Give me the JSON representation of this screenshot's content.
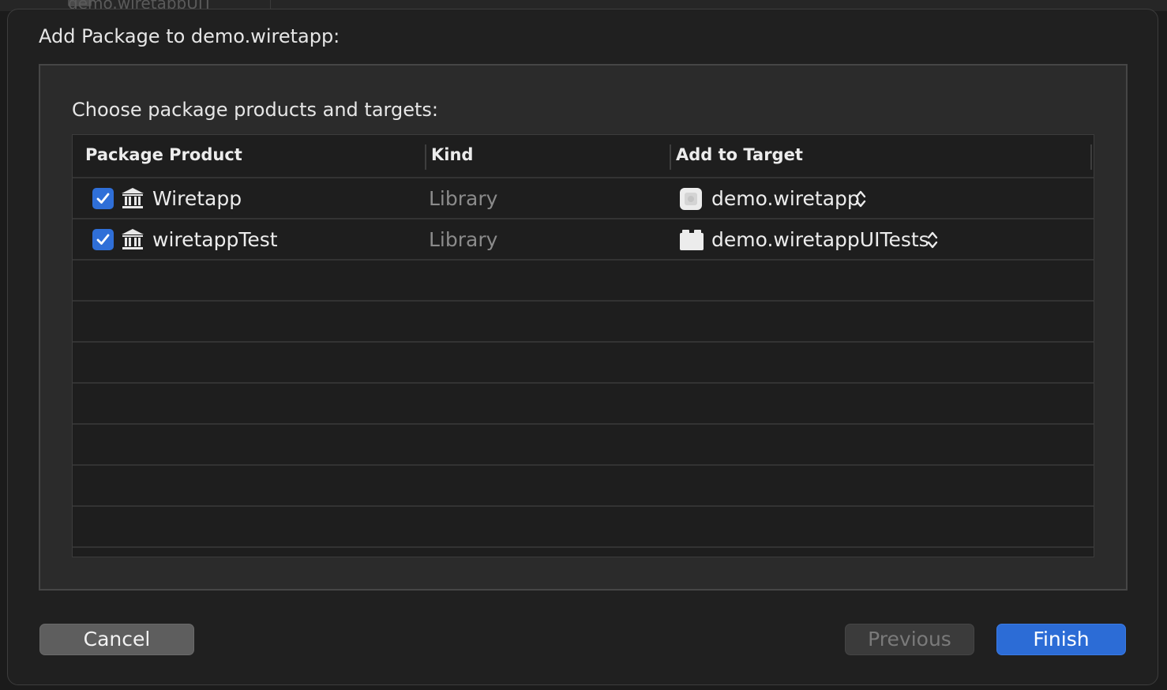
{
  "background": {
    "window_fragment_text": "demo.wiretappUIT"
  },
  "dialog": {
    "title": "Add Package to demo.wiretapp:",
    "subtitle": "Choose package products and targets:",
    "table": {
      "columns": [
        "Package Product",
        "Kind",
        "Add to Target"
      ],
      "rows": [
        {
          "checked": true,
          "product_icon": "library-icon",
          "product": "Wiretapp",
          "kind": "Library",
          "target_icon": "app-target-icon",
          "target": "demo.wiretapp"
        },
        {
          "checked": true,
          "product_icon": "library-icon",
          "product": "wiretappTest",
          "kind": "Library",
          "target_icon": "test-bundle-icon",
          "target": "demo.wiretappUITests"
        }
      ],
      "empty_row_count": 7
    },
    "buttons": {
      "cancel": "Cancel",
      "previous": "Previous",
      "finish": "Finish"
    }
  },
  "colors": {
    "accent": "#2c6cd6",
    "checkbox": "#2f6fd8",
    "dialog_bg": "#202020",
    "panel_bg": "#2b2b2b",
    "disabled_text": "#7a7a7a"
  }
}
